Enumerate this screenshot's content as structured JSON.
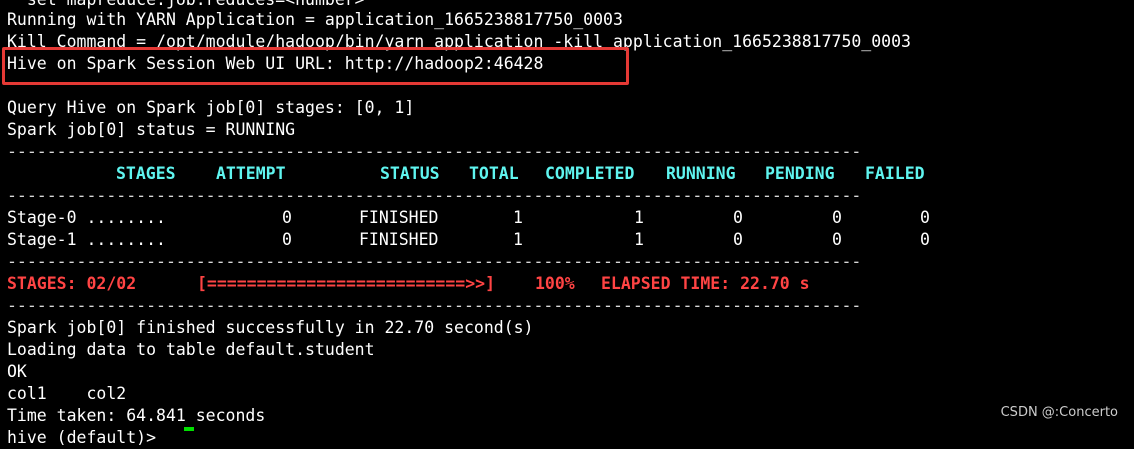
{
  "terminal": {
    "line_partial_top": "  set mapreduce.job.reduces=<number>",
    "line_yarn_app": "Running with YARN Application = application_1665238817750_0003",
    "line_kill_cmd": "Kill Command = /opt/module/hadoop/bin/yarn application -kill application_1665238817750_0003",
    "line_webui": "Hive on Spark Session Web UI URL: http://hadoop2:46428",
    "line_query": "Query Hive on Spark job[0] stages: [0, 1]",
    "line_status": "Spark job[0] status = RUNNING",
    "separator": "--------------------------------------------------------------------------------------",
    "table": {
      "headers": [
        "STAGES",
        "ATTEMPT",
        "STATUS",
        "TOTAL",
        "COMPLETED",
        "RUNNING",
        "PENDING",
        "FAILED"
      ],
      "rows": [
        [
          "Stage-0 ........",
          "0",
          "FINISHED",
          "1",
          "1",
          "0",
          "0",
          "0"
        ],
        [
          "Stage-1 ........",
          "0",
          "FINISHED",
          "1",
          "1",
          "0",
          "0",
          "0"
        ]
      ]
    },
    "progress": {
      "stages_label": "STAGES: 02/02",
      "bar": "[==========================>>]",
      "percent": "100%",
      "elapsed": "ELAPSED TIME: 22.70 s",
      "fraction": 1.0
    },
    "line_finished": "Spark job[0] finished successfully in 22.70 second(s)",
    "line_loading": "Loading data to table default.student",
    "line_ok": "OK",
    "line_cols": "col1    col2",
    "line_time": "Time taken: 64.841 seconds",
    "line_prompt_partial": "hive (default)> "
  },
  "colors": {
    "background": "#000000",
    "text": "#ffffff",
    "header_cyan": "#5ff5f0",
    "progress_red": "#ff4444",
    "highlight_box": "#e53935",
    "cursor": "#00e000"
  },
  "watermark": "CSDN @:Concerto"
}
